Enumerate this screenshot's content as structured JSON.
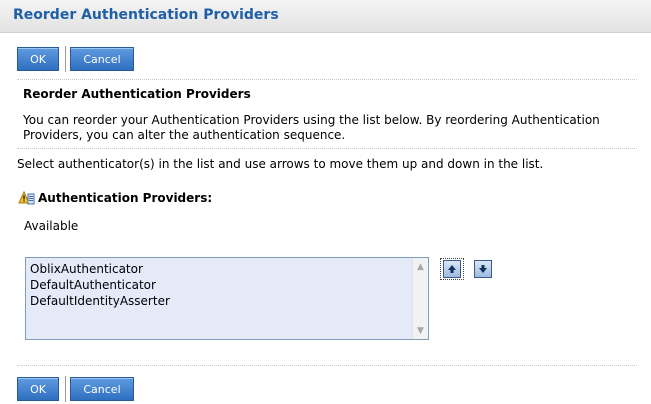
{
  "page": {
    "title": "Reorder Authentication Providers"
  },
  "toolbar": {
    "ok_label": "OK",
    "cancel_label": "Cancel"
  },
  "section": {
    "title": "Reorder Authentication Providers",
    "description": "You can reorder your Authentication Providers using the list below. By reordering Authentication Providers, you can alter the authentication sequence."
  },
  "instructions": "Select authenticator(s) in the list and use arrows to move them up and down in the list.",
  "providers": {
    "heading": "Authentication Providers:",
    "available_label": "Available",
    "items": [
      "OblixAuthenticator",
      "DefaultAuthenticator",
      "DefaultIdentityAsserter"
    ]
  },
  "icons": {
    "heading_icon": "warning-icon",
    "move_up": "arrow-up-icon",
    "move_down": "arrow-down-icon"
  },
  "colors": {
    "title": "#1f5fa8",
    "button": "#2f6fc0",
    "listbox_bg": "#e4eaf8"
  }
}
